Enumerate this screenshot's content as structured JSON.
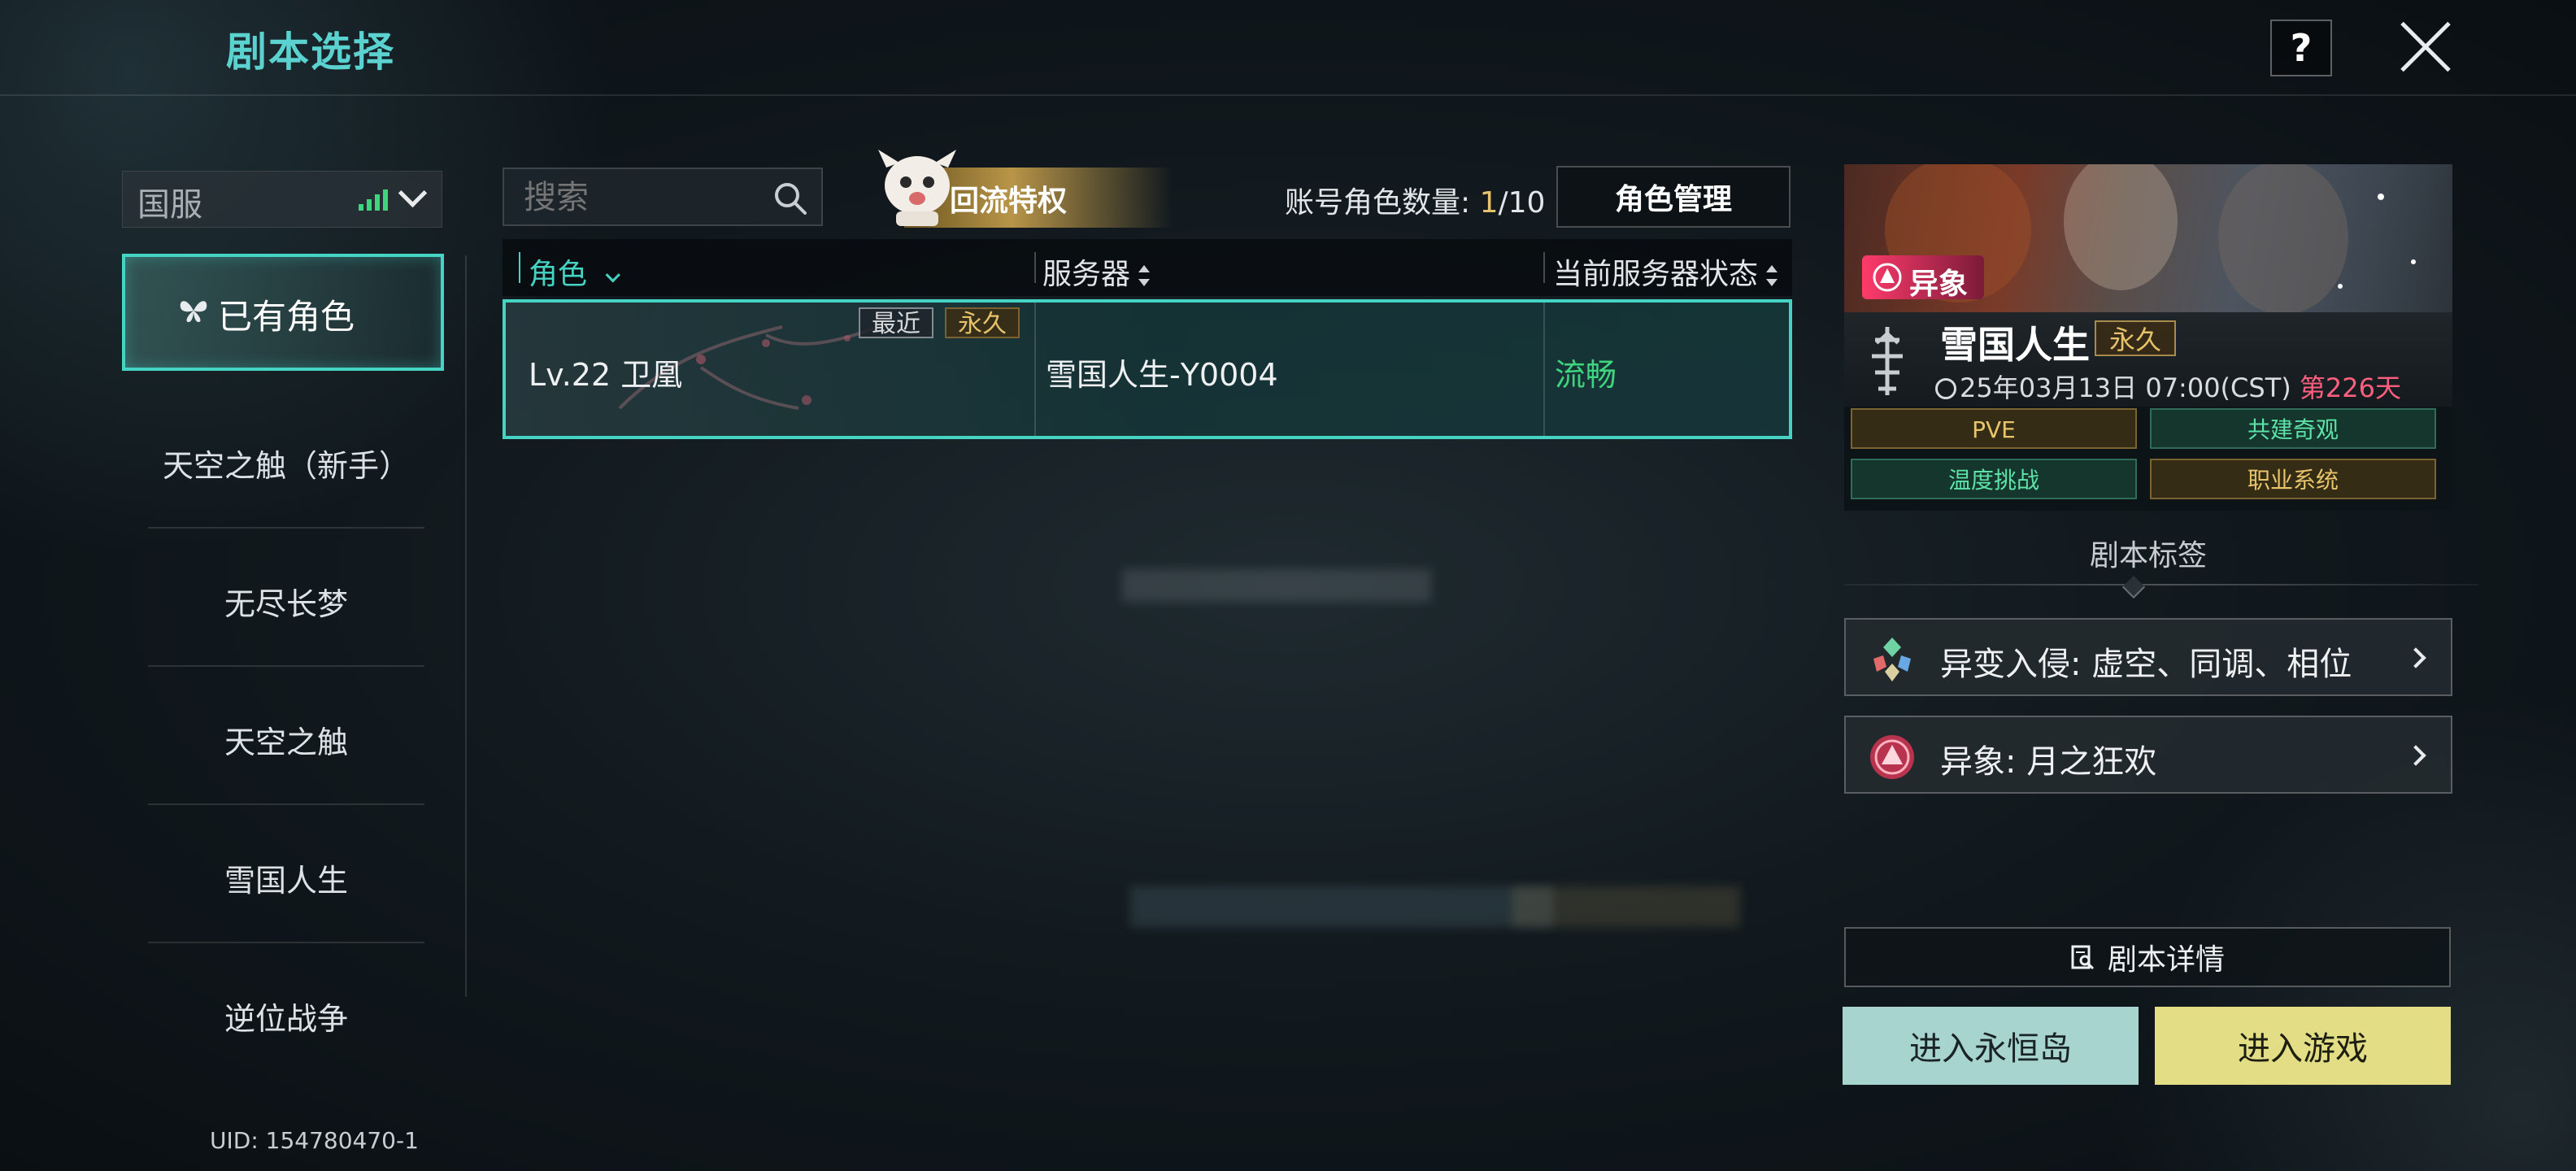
{
  "header": {
    "title": "剧本选择",
    "help_label": "?"
  },
  "region": {
    "label": "国服"
  },
  "sidebar": {
    "items": [
      {
        "label": "已有角色"
      },
      {
        "label": "天空之触（新手）"
      },
      {
        "label": "无尽长梦"
      },
      {
        "label": "天空之触"
      },
      {
        "label": "雪国人生"
      },
      {
        "label": "逆位战争"
      }
    ]
  },
  "uid": "UID: 154780470-1",
  "search": {
    "placeholder": "搜索"
  },
  "privilege": {
    "label": "回流特权"
  },
  "account": {
    "count_label": "账号角色数量: ",
    "current": "1",
    "max": "/10",
    "manage_label": "角色管理"
  },
  "table": {
    "columns": [
      "角色",
      "服务器",
      "当前服务器状态"
    ],
    "rows": [
      {
        "role": "Lv.22 卫凰",
        "server": "雪国人生-Y0004",
        "status": "流畅",
        "tags": [
          "最近",
          "永久"
        ]
      }
    ]
  },
  "script_card": {
    "badge": "异象",
    "title": "雪国人生",
    "permanent_tag": "永久",
    "date": "25年03月13日 07:00(CST)",
    "day_count": "第226天",
    "tags": [
      "PVE",
      "共建奇观",
      "温度挑战",
      "职业系统"
    ]
  },
  "script_label": "剧本标签",
  "features": [
    {
      "label": "异变入侵: 虚空、同调、相位"
    },
    {
      "label": "异象: 月之狂欢"
    }
  ],
  "buttons": {
    "detail": "剧本详情",
    "island": "进入永恒岛",
    "enter": "进入游戏"
  },
  "colors": {
    "accent": "#45d3c4",
    "title": "#5bd2cf",
    "gold": "#e6c36a",
    "status_ok": "#3fd47d",
    "red": "#ff5f7e"
  }
}
